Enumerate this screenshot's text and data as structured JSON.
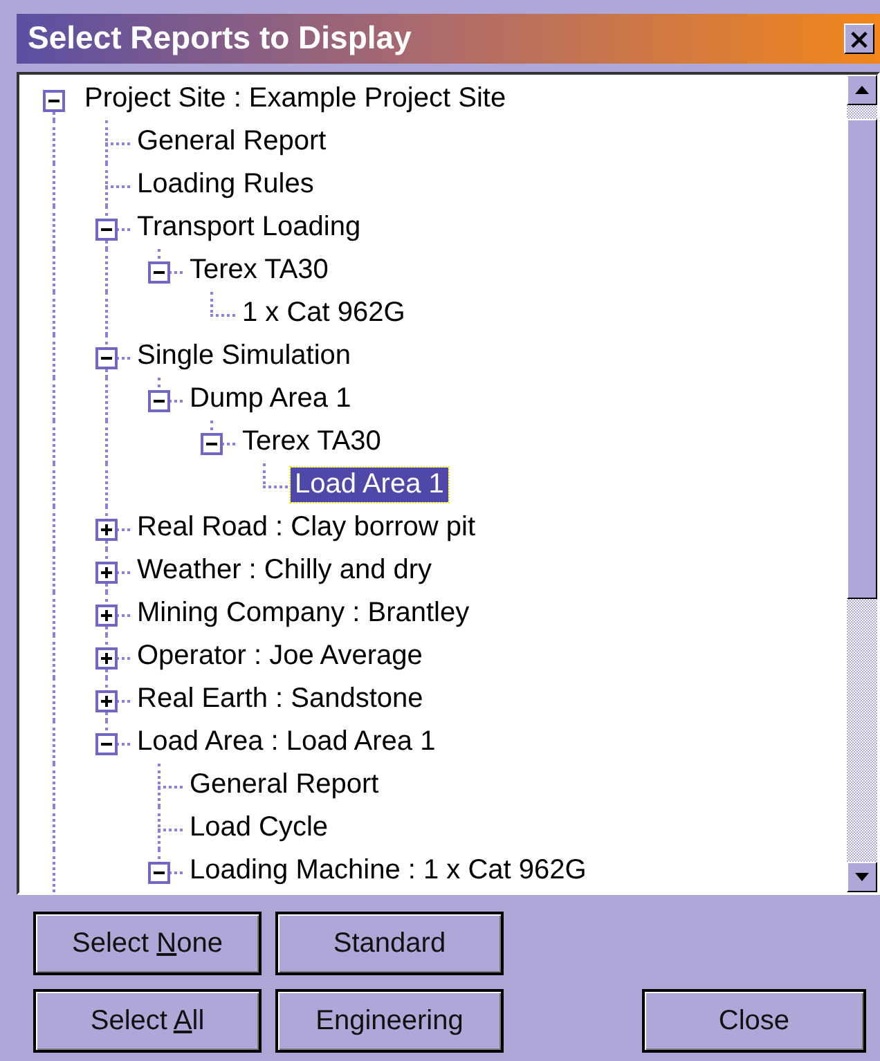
{
  "window": {
    "title": "Select Reports to Display",
    "close_glyph": "×"
  },
  "tree": [
    {
      "label": "Project Site : Example Project Site",
      "kind": "branch",
      "expanded": true,
      "selected": false,
      "children": [
        {
          "label": "General Report",
          "kind": "leaf",
          "selected": false
        },
        {
          "label": "Loading Rules",
          "kind": "leaf",
          "selected": false
        },
        {
          "label": "Transport Loading",
          "kind": "branch",
          "expanded": true,
          "selected": false,
          "children": [
            {
              "label": "Terex TA30",
              "kind": "branch",
              "expanded": true,
              "selected": false,
              "children": [
                {
                  "label": "1 x Cat 962G",
                  "kind": "leaf",
                  "selected": false
                }
              ]
            }
          ]
        },
        {
          "label": "Single Simulation",
          "kind": "branch",
          "expanded": true,
          "selected": false,
          "children": [
            {
              "label": "Dump Area 1",
              "kind": "branch",
              "expanded": true,
              "selected": false,
              "children": [
                {
                  "label": "Terex TA30",
                  "kind": "branch",
                  "expanded": true,
                  "selected": false,
                  "children": [
                    {
                      "label": "Load Area 1",
                      "kind": "leaf",
                      "selected": true
                    }
                  ]
                }
              ]
            }
          ]
        },
        {
          "label": "Real Road : Clay borrow pit",
          "kind": "branch",
          "expanded": false,
          "selected": false
        },
        {
          "label": "Weather : Chilly and dry",
          "kind": "branch",
          "expanded": false,
          "selected": false
        },
        {
          "label": "Mining Company : Brantley",
          "kind": "branch",
          "expanded": false,
          "selected": false
        },
        {
          "label": "Operator : Joe Average",
          "kind": "branch",
          "expanded": false,
          "selected": false
        },
        {
          "label": "Real Earth : Sandstone",
          "kind": "branch",
          "expanded": false,
          "selected": false
        },
        {
          "label": "Load Area : Load Area 1",
          "kind": "branch",
          "expanded": true,
          "selected": false,
          "children": [
            {
              "label": "General Report",
              "kind": "leaf",
              "selected": false
            },
            {
              "label": "Load Cycle",
              "kind": "leaf",
              "selected": false
            },
            {
              "label": "Loading Machine : 1 x Cat 962G",
              "kind": "branch",
              "expanded": true,
              "selected": false
            }
          ]
        }
      ]
    }
  ],
  "buttons": [
    {
      "label_before": "Select ",
      "accel": "N",
      "label_after": "one"
    },
    {
      "label_after": "Standard"
    },
    {
      "label_before": "Select ",
      "accel": "A",
      "label_after": "ll"
    },
    {
      "label_after": "Engineering"
    },
    {
      "label_after": "Close"
    }
  ]
}
